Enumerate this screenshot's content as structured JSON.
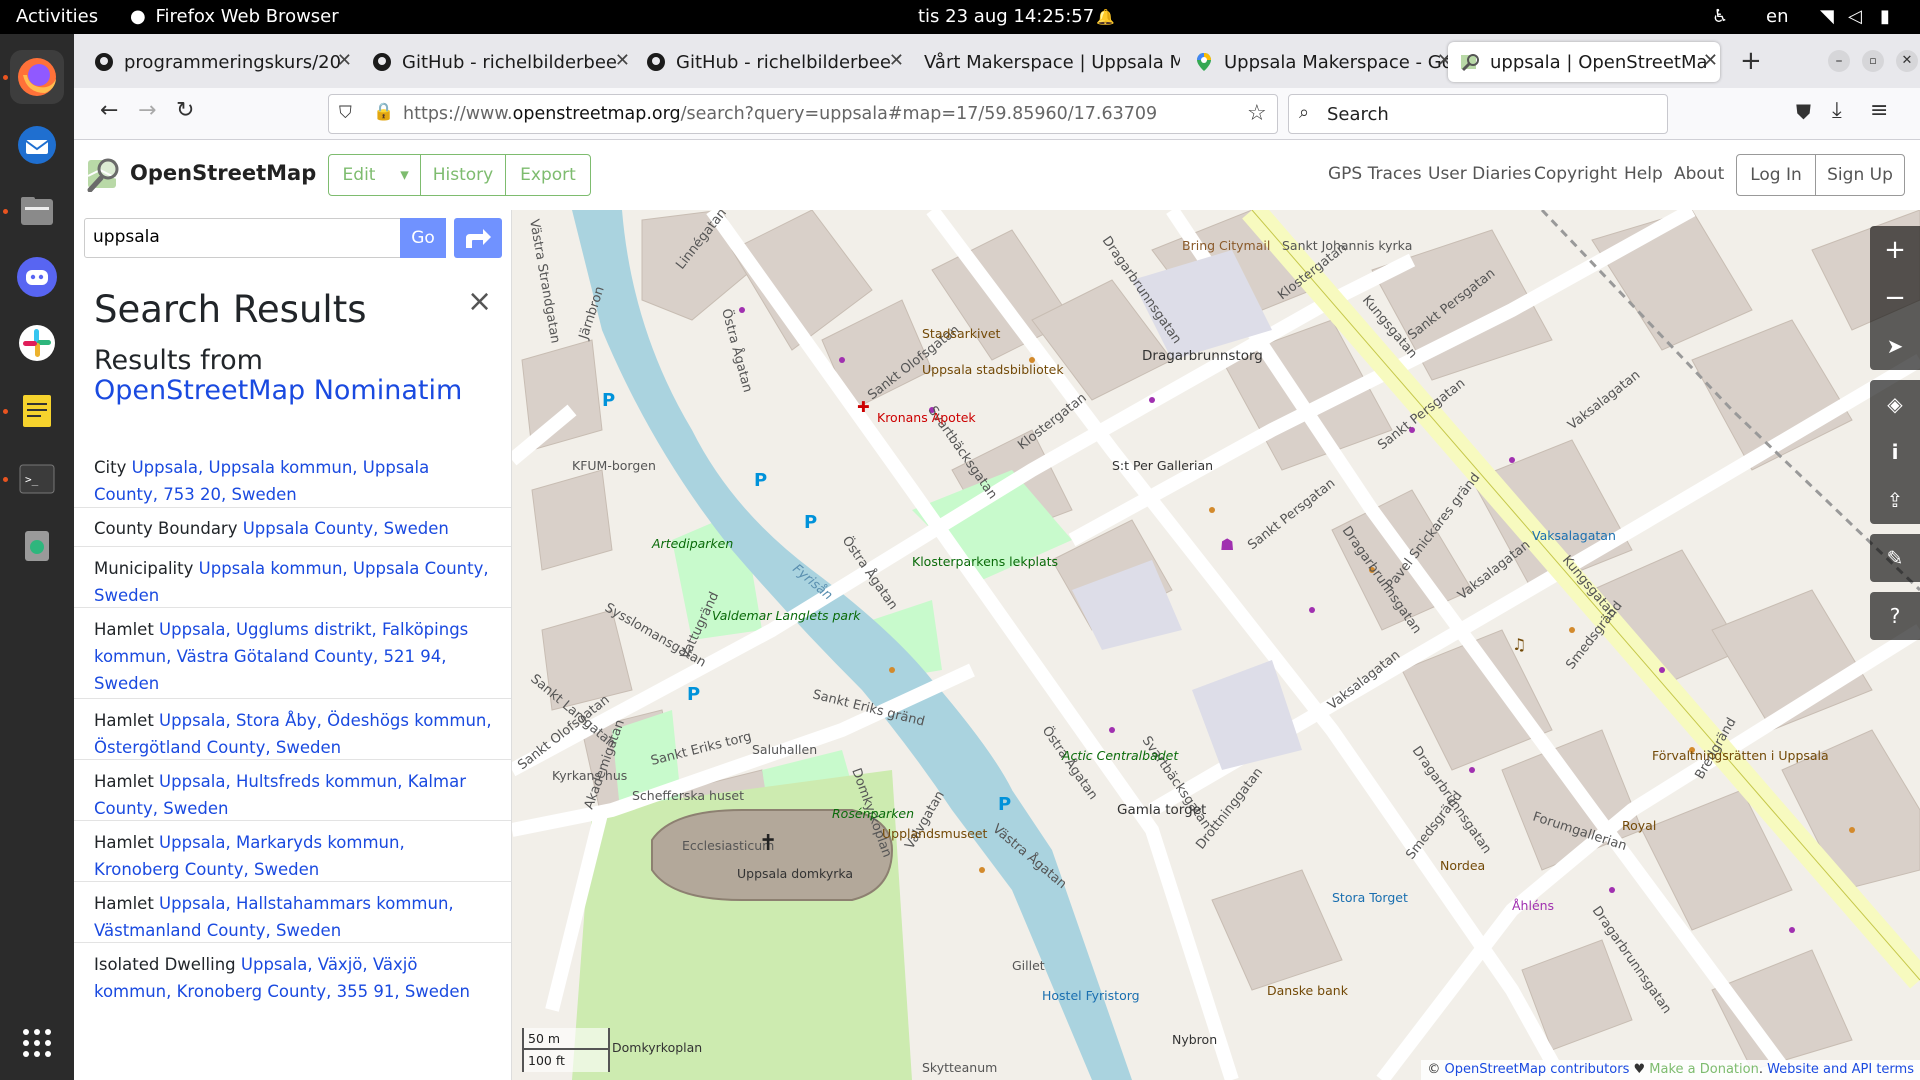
{
  "system": {
    "activities": "Activities",
    "app_name": "Firefox Web Browser",
    "datetime": "tis 23 aug  14:25:57",
    "language": "en"
  },
  "browser": {
    "tabs": [
      {
        "title": "programmeringskurs/20",
        "icon": "github-icon"
      },
      {
        "title": "GitHub - richelbilderbee",
        "icon": "github-icon"
      },
      {
        "title": "GitHub - richelbilderbee",
        "icon": "github-icon"
      },
      {
        "title": "Vårt Makerspace | Uppsala M",
        "icon": "none"
      },
      {
        "title": "Uppsala Makerspace - Go",
        "icon": "maps-pin-icon"
      },
      {
        "title": "uppsala | OpenStreetMa",
        "icon": "osm-icon"
      }
    ],
    "url_prefix": "https://www.",
    "url_domain": "openstreetmap.org",
    "url_suffix": "/search?query=uppsala#map=17/59.85960/17.63709",
    "search_placeholder": "Search"
  },
  "osm": {
    "logo_text": "OpenStreetMap",
    "buttons": {
      "edit": "Edit",
      "history": "History",
      "export": "Export"
    },
    "nav_links": [
      "GPS Traces",
      "User Diaries",
      "Copyright",
      "Help",
      "About"
    ],
    "login": "Log In",
    "signup": "Sign Up",
    "search_value": "uppsala",
    "go_label": "Go"
  },
  "sidebar": {
    "title": "Search Results",
    "subtitle_prefix": "Results from",
    "subtitle_link": "OpenStreetMap Nominatim",
    "results": [
      {
        "type": "City",
        "text": "Uppsala, Uppsala kommun, Uppsala County, 753 20, Sweden"
      },
      {
        "type": "County Boundary",
        "text": "Uppsala County, Sweden"
      },
      {
        "type": "Municipality",
        "text": "Uppsala kommun, Uppsala County, Sweden"
      },
      {
        "type": "Hamlet",
        "text": "Uppsala, Ugglums distrikt, Falköpings kommun, Västra Götaland County, 521 94, Sweden"
      },
      {
        "type": "Hamlet",
        "text": "Uppsala, Stora Åby, Ödeshögs kommun, Östergötland County, Sweden"
      },
      {
        "type": "Hamlet",
        "text": "Uppsala, Hultsfreds kommun, Kalmar County, Sweden"
      },
      {
        "type": "Hamlet",
        "text": "Uppsala, Markaryds kommun, Kronoberg County, Sweden"
      },
      {
        "type": "Hamlet",
        "text": "Uppsala, Hallstahammars kommun, Västmanland County, Sweden"
      },
      {
        "type": "Isolated Dwelling",
        "text": "Uppsala, Växjö, Växjö kommun, Kronoberg County, 355 91, Sweden"
      }
    ]
  },
  "map": {
    "labels": {
      "bring": "Bring Citymail",
      "sankt_johannis": "Sankt Johannis kyrka",
      "stadsarkivet": "Stadsarkivet",
      "stadsbibliotek": "Uppsala stadsbibliotek",
      "kronans": "Kronans Apotek",
      "dragarbrunnstorg": "Dragarbrunnstorg",
      "st_per_gallerian": "S:t Per Gallerian",
      "klosterparkens": "Klosterparkens lekplats",
      "kfum": "KFUM-borgen",
      "artediparken": "Artediparken",
      "valdemar": "Valdemar Langlets park",
      "saluhallen": "Saluhallen",
      "kyrkans_hus": "Kyrkans hus",
      "schefferska": "Schefferska huset",
      "roseparken": "Rosénparken",
      "upplandsmuseet": "Upplandsmuseet",
      "ecclesiasticum": "Ecclesiasticum",
      "domkyrka": "Uppsala domkyrka",
      "domkyrkoplan": "Domkyrkoplan",
      "skytteanum": "Skytteanum",
      "actic": "Actic Centralbadet",
      "gamla_torget": "Gamla torget",
      "stora_torget": "Stora Torget",
      "nordea": "Nordea",
      "ahlens": "Åhléns",
      "royal": "Royal",
      "forvaltningsratten": "Förvaltningsrätten i Uppsala",
      "vaksalagatan_stop": "Vaksalagatan",
      "hostel": "Hostel Fyristorg",
      "gillet": "Gillet",
      "danske": "Danske bank",
      "nybron": "Nybron",
      "fyrisan": "Fyrisån"
    },
    "streets": {
      "kungsgatan": "Kungsgatan",
      "klostergatan": "Klostergatan",
      "dragarbrunnsgatan": "Dragarbrunnsgatan",
      "sankt_olofsgatan": "Sankt Olofsgatan",
      "svartbacksgatan": "Svartbäcksgatan",
      "sankt_persgatan": "Sankt Persgatan",
      "ostra_agatan": "Östra Ågatan",
      "vastra_agatan": "Västra Ågatan",
      "linnegatan": "Linnégatan",
      "jarnbron": "Järnbron",
      "vastra_strandgatan": "Västra Strandgatan",
      "sysslomansgatan": "Sysslomansgatan",
      "vattugrand": "Vattugränd",
      "sankt_larsgatan": "Sankt Larsgatan",
      "akademigatan": "Akademigatan",
      "sankt_eriks_torg": "Sankt Eriks torg",
      "sankt_eriks_grand": "Sankt Eriks gränd",
      "domkyrkoplan_st": "Domkyrkoplan",
      "valvgatan": "Valvgatan",
      "drottninggatan": "Drottninggatan",
      "smedsgrand": "Smedsgränd",
      "vaksalagatan": "Vaksalagatan",
      "pavel": "Pavel Snickares gränd",
      "forumgallerian": "Forumgallerian",
      "bredgrand": "Bredgränd"
    },
    "scale": {
      "metric": "50 m",
      "imperial": "100 ft"
    },
    "attribution": {
      "copyright": "© ",
      "contributors": "OpenStreetMap contributors",
      "heart": " ♥ ",
      "donate": "Make a Donation",
      "sep": ". ",
      "terms": "Website and API terms"
    }
  },
  "colors": {
    "osm_green": "#7ebc6f",
    "link_blue": "#1a4ae0",
    "water": "#aad3df",
    "park": "#c8facc",
    "primary_road": "#fcd6a4",
    "kungsgatan": "#f7fabf"
  }
}
